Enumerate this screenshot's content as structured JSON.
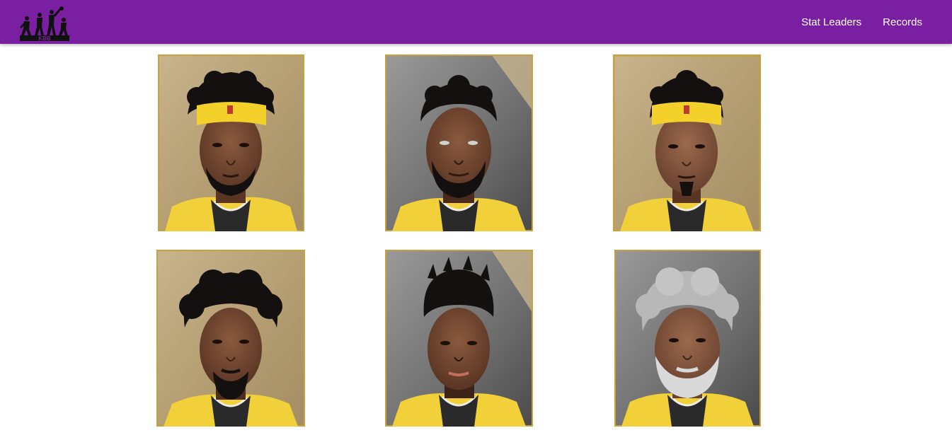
{
  "header": {
    "logo_text": "KBB",
    "nav": [
      {
        "label": "Stat Leaders"
      },
      {
        "label": "Records"
      }
    ]
  },
  "colors": {
    "navbar": "#7b1fa2",
    "card_gold_border": "#c9a13b",
    "jersey_yellow": "#f2d03a",
    "headband_yellow": "#f3d02a"
  },
  "players": [
    {
      "card": "player-card-1",
      "bg": "gold",
      "hair": "black-curly",
      "headband": true,
      "beard": "goatee"
    },
    {
      "card": "player-card-2",
      "bg": "gray",
      "hair": "black-short",
      "headband": false,
      "beard": "full"
    },
    {
      "card": "player-card-3",
      "bg": "gold",
      "hair": "black-curly",
      "headband": true,
      "beard": "goatee"
    },
    {
      "card": "player-card-4",
      "bg": "gold",
      "hair": "black-afro",
      "headband": false,
      "beard": "full"
    },
    {
      "card": "player-card-5",
      "bg": "gray",
      "hair": "black-twists",
      "headband": false,
      "beard": "none"
    },
    {
      "card": "player-card-6",
      "bg": "gray",
      "hair": "gray-curly",
      "headband": false,
      "beard": "gray-full"
    }
  ]
}
